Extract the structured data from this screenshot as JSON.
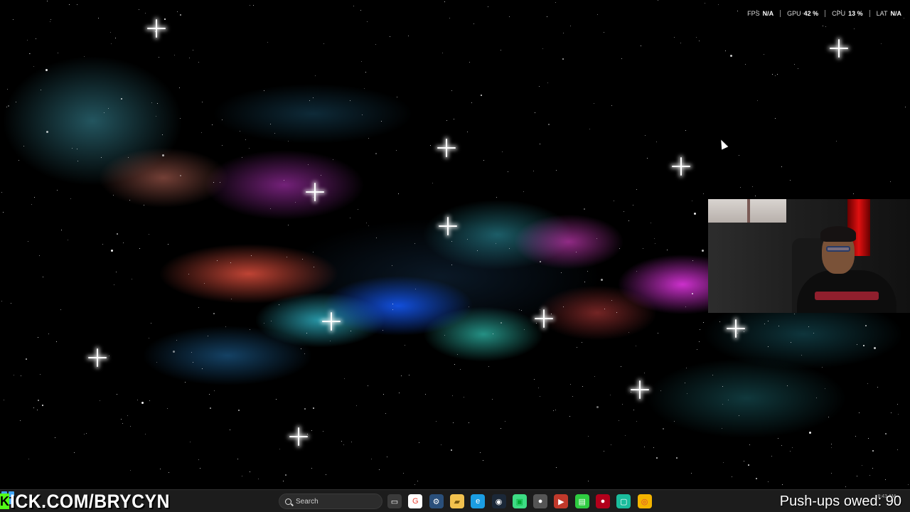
{
  "performance_overlay": {
    "fps": {
      "label": "FPS",
      "value": "N/A"
    },
    "gpu": {
      "label": "GPU",
      "value": "42 %"
    },
    "cpu": {
      "label": "CPU",
      "value": "13 %"
    },
    "lat": {
      "label": "LAT",
      "value": "N/A"
    }
  },
  "stream_overlay": {
    "kick_url": "ICK.COM/BRYCYN",
    "kick_logo_letter": "K",
    "pushups_text": "Push-ups owed: 90"
  },
  "taskbar": {
    "search_placeholder": "Search",
    "clock_time": "8:43 AM",
    "pinned": [
      {
        "name": "task-view-icon",
        "glyph": "▭",
        "bg": "#3a3a3a"
      },
      {
        "name": "google-icon",
        "glyph": "G",
        "bg": "#ffffff",
        "fg": "#ea4335"
      },
      {
        "name": "settings-gear-icon",
        "glyph": "⚙",
        "bg": "#2a4f7a"
      },
      {
        "name": "file-explorer-icon",
        "glyph": "▰",
        "bg": "#f2c14e",
        "fg": "#7a5a10"
      },
      {
        "name": "edge-icon",
        "glyph": "e",
        "bg": "#1b9de2"
      },
      {
        "name": "steam-icon",
        "glyph": "◉",
        "bg": "#1b2838"
      },
      {
        "name": "android-app-icon",
        "glyph": "▣",
        "bg": "#3ddc84",
        "fg": "#0a3"
      },
      {
        "name": "chrome-dark-icon",
        "glyph": "●",
        "bg": "#555555"
      },
      {
        "name": "video-editor-icon",
        "glyph": "▶",
        "bg": "#c0392b"
      },
      {
        "name": "green-app-icon",
        "glyph": "▤",
        "bg": "#2ecc40"
      },
      {
        "name": "red-app-icon",
        "glyph": "●",
        "bg": "#b3001b"
      },
      {
        "name": "teal-app-icon",
        "glyph": "▢",
        "bg": "#1abc9c"
      },
      {
        "name": "chrome-icon",
        "glyph": "◎",
        "bg": "#f4b400",
        "fg": "#db4437"
      }
    ]
  },
  "colors": {
    "kick_green": "#53fc18",
    "taskbar_bg": "#1c1c1c",
    "windows_blue": "#3fa5f5"
  }
}
